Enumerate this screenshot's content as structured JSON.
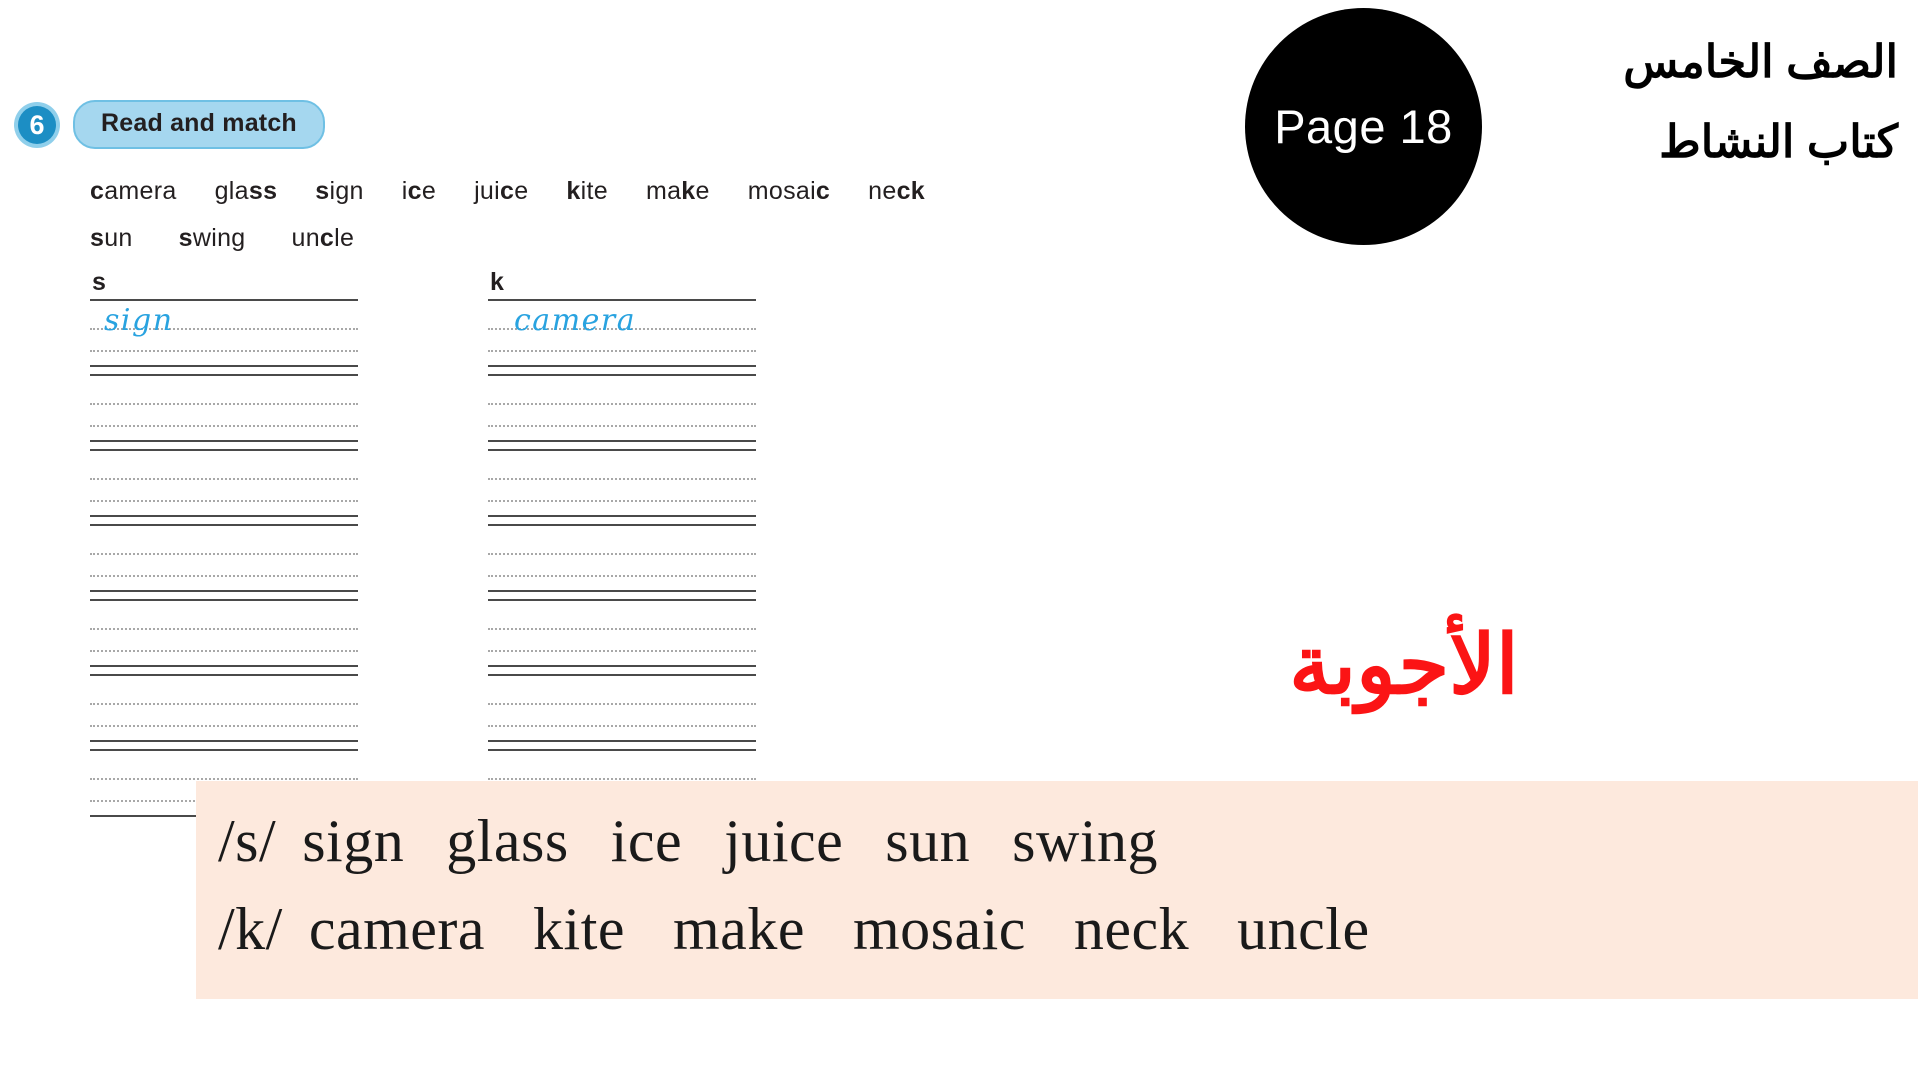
{
  "exercise": {
    "number": "6",
    "instruction": "Read and match"
  },
  "word_bank": {
    "rows": [
      [
        {
          "text": "camera",
          "bold": "c",
          "bold_at": "start"
        },
        {
          "text": "glass",
          "bold": "ss",
          "bold_at": "end"
        },
        {
          "text": "sign",
          "bold": "s",
          "bold_at": "start"
        },
        {
          "text": "ice",
          "bold": "c",
          "bold_at": "mid"
        },
        {
          "text": "juice",
          "bold": "c",
          "bold_at": "mid"
        },
        {
          "text": "kite",
          "bold": "k",
          "bold_at": "start"
        },
        {
          "text": "make",
          "bold": "k",
          "bold_at": "mid"
        },
        {
          "text": "mosaic",
          "bold": "c",
          "bold_at": "end"
        },
        {
          "text": "neck",
          "bold": "ck",
          "bold_at": "end"
        }
      ],
      [
        {
          "text": "sun",
          "bold": "s",
          "bold_at": "start"
        },
        {
          "text": "swing",
          "bold": "s",
          "bold_at": "start"
        },
        {
          "text": "uncle",
          "bold": "c",
          "bold_at": "mid"
        }
      ]
    ]
  },
  "columns": [
    {
      "letter": "s",
      "handwritten_answer": "sign"
    },
    {
      "letter": "k",
      "handwritten_answer": "camera"
    }
  ],
  "page_badge": {
    "label": "Page 18"
  },
  "arabic_header": {
    "line1": "الصف الخامس",
    "line2": "كتاب النشاط"
  },
  "answers_label": "الأجوبة",
  "answer_key": {
    "rows": [
      {
        "key": "/s/",
        "words": [
          "sign",
          "glass",
          "ice",
          "juice",
          "sun",
          "swing"
        ]
      },
      {
        "key": "/k/",
        "words": [
          "camera",
          "kite",
          "make",
          "mosaic",
          "neck",
          "uncle"
        ]
      }
    ]
  },
  "colors": {
    "badge_blue_dark": "#1c8ec4",
    "badge_blue_light": "#a5d7ef",
    "handwriting_blue": "#29a3e0",
    "answers_red": "#fb1415",
    "answer_box_bg": "#fde9dd",
    "page_badge_bg": "#000000"
  }
}
